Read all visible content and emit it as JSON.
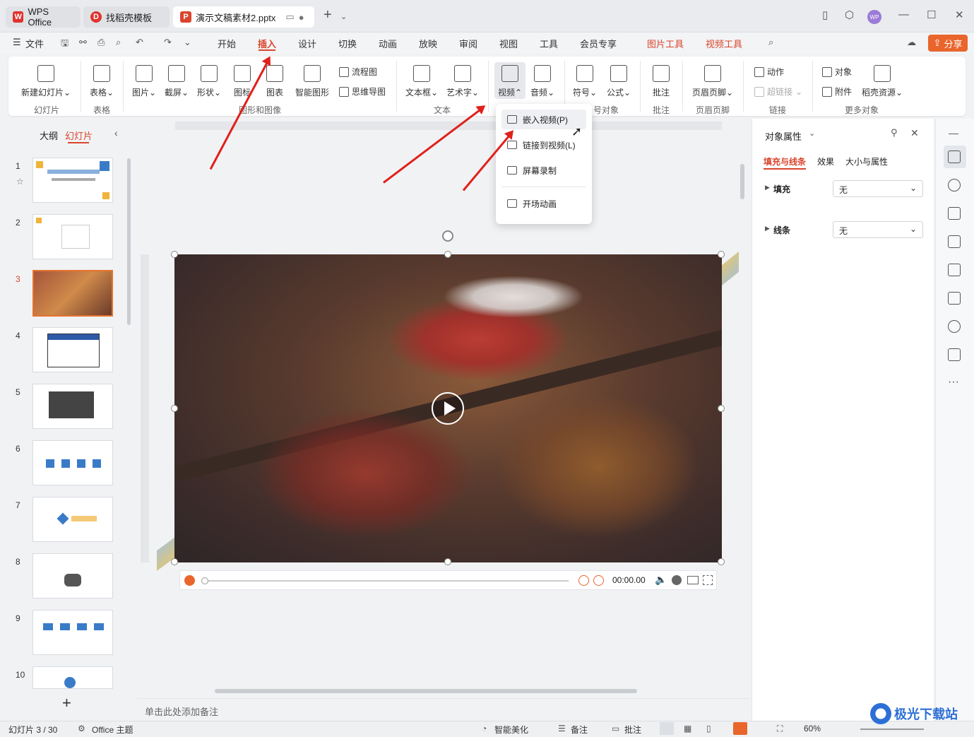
{
  "titlebar": {
    "tabs": [
      {
        "label": "WPS Office"
      },
      {
        "label": "找稻壳模板"
      },
      {
        "label": "演示文稿素材2.pptx"
      }
    ],
    "new_tab": "+",
    "avatar": "WP"
  },
  "menubar": {
    "file": "文件",
    "items": [
      "开始",
      "插入",
      "设计",
      "切换",
      "动画",
      "放映",
      "审阅",
      "视图",
      "工具",
      "会员专享",
      "图片工具",
      "视频工具"
    ],
    "share": "分享"
  },
  "ribbon": {
    "new_slide": "新建幻灯片",
    "table": "表格",
    "picture": "图片",
    "screenshot": "截屏",
    "shape": "形状",
    "icon": "图标",
    "chart": "图表",
    "smartart": "智能图形",
    "flowchart": "流程图",
    "mindmap": "思维导图",
    "textbox": "文本框",
    "wordart": "艺术字",
    "video": "视频",
    "audio": "音频",
    "symbol": "符号",
    "formula": "公式",
    "comment": "批注",
    "header_footer": "页眉页脚",
    "action": "动作",
    "hyperlink": "超链接",
    "object": "对象",
    "attachment": "附件",
    "docer": "稻壳资源",
    "groups": [
      "幻灯片",
      "表格",
      "图形和图像",
      "文本",
      "号对象",
      "批注",
      "页眉页脚",
      "链接",
      "更多对象"
    ]
  },
  "dropdown": {
    "items": [
      "嵌入视频(P)",
      "链接到视频(L)",
      "屏幕录制",
      "开场动画"
    ]
  },
  "leftpanel": {
    "tab_outline": "大纲",
    "tab_slides": "幻灯片",
    "slides": [
      "1",
      "2",
      "3",
      "4",
      "5",
      "6",
      "7",
      "8",
      "9",
      "10"
    ],
    "add": "+"
  },
  "player": {
    "time": "00:00.00"
  },
  "rightpanel": {
    "title": "对象属性",
    "tabs": [
      "填充与线条",
      "效果",
      "大小与属性"
    ],
    "fill_label": "填充",
    "fill_value": "无",
    "line_label": "线条",
    "line_value": "无"
  },
  "notes": {
    "placeholder": "单击此处添加备注"
  },
  "status": {
    "slide_count": "幻灯片 3 / 30",
    "theme": "Office 主题",
    "beautify": "智能美化",
    "notes": "备注",
    "comments": "批注",
    "zoom": "60%"
  },
  "watermark": "极光下载站",
  "colors": {
    "accent": "#d9452c",
    "share": "#e9652c",
    "arrow": "#e0201b"
  }
}
